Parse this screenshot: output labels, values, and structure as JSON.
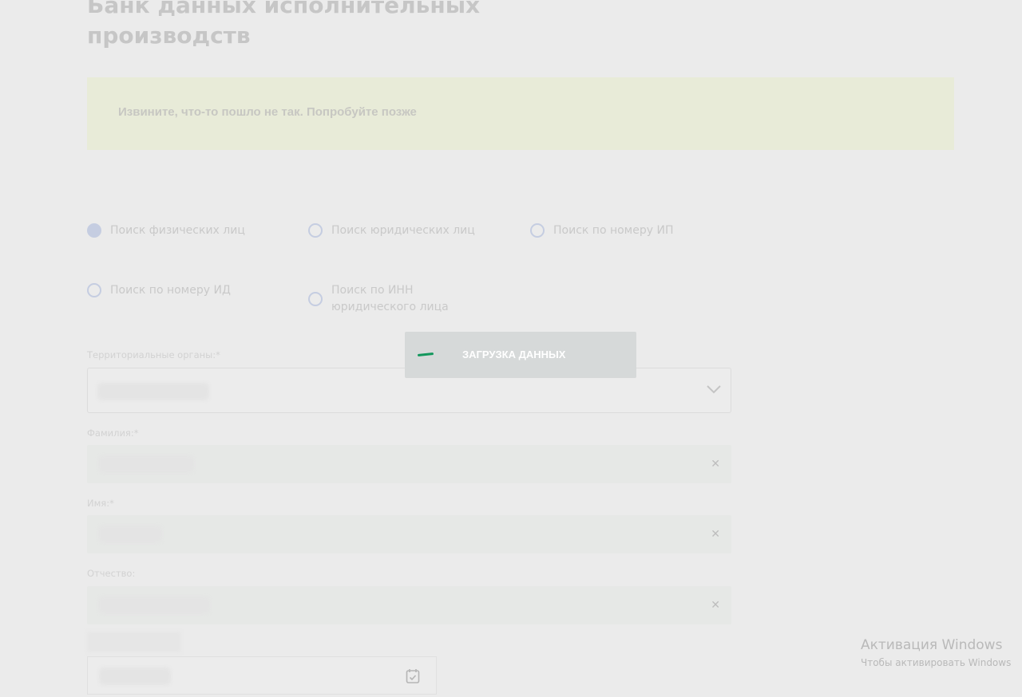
{
  "page": {
    "title": "Банк данных исполнительных производств"
  },
  "alert": {
    "message": "Извините, что-то пошло не так. Попробуйте позже"
  },
  "search_types": [
    {
      "label": "Поиск физических лиц",
      "checked": true
    },
    {
      "label": "Поиск юридических лиц",
      "checked": false
    },
    {
      "label": "Поиск по номеру ИП",
      "checked": false
    },
    {
      "label": "Поиск по номеру ИД",
      "checked": false
    },
    {
      "label": "Поиск по ИНН юридического лица",
      "checked": false
    }
  ],
  "form": {
    "territorial_label": "Территориальные органы:*",
    "lastname_label": "Фамилия:*",
    "firstname_label": "Имя:*",
    "patronymic_label": "Отчество:"
  },
  "loader": {
    "text": "ЗАГРУЗКА ДАННЫХ"
  },
  "watermark": {
    "title": "Активация Windows",
    "subtitle": "Чтобы активировать Windows"
  },
  "colors": {
    "accent": "#12975c",
    "background": "#ebebeb",
    "alert_bg": "#e8ebd8"
  },
  "icons": {
    "dropdown": "chevron-down-icon",
    "clear": "close-icon",
    "date": "calendar-icon"
  }
}
